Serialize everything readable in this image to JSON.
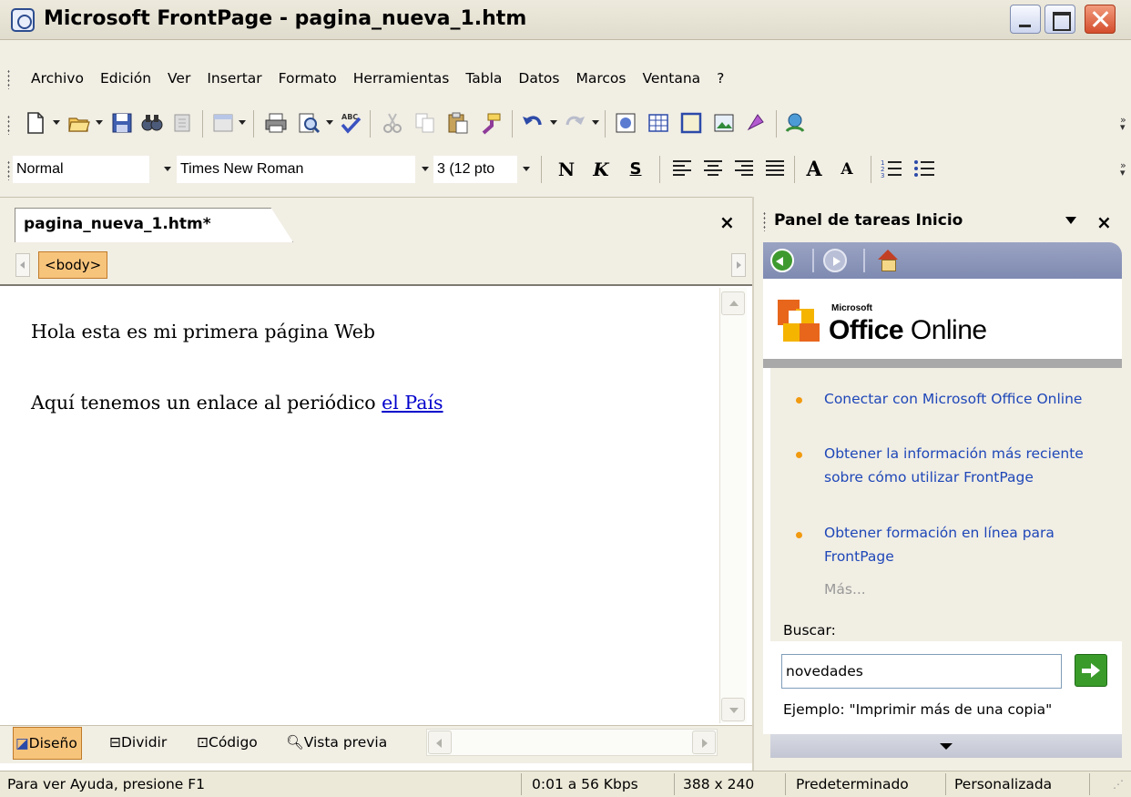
{
  "window": {
    "title": "Microsoft FrontPage - pagina_nueva_1.htm"
  },
  "menu": [
    "Archivo",
    "Edición",
    "Ver",
    "Insertar",
    "Formato",
    "Herramientas",
    "Tabla",
    "Datos",
    "Marcos",
    "Ventana",
    "?"
  ],
  "toolbar1": {
    "icons": [
      "new-page-icon",
      "open-folder-icon",
      "save-icon",
      "search-icon",
      "publish-icon",
      "web-component-icon",
      "print-icon",
      "print-preview-icon",
      "spelling-icon",
      "cut-icon",
      "copy-icon",
      "paste-icon",
      "format-painter-icon",
      "undo-icon",
      "redo-icon",
      "web-component-insert-icon",
      "insert-table-icon",
      "insert-layer-icon",
      "insert-picture-icon",
      "drawing-icon",
      "hyperlink-icon"
    ]
  },
  "toolbar2": {
    "style": "Normal",
    "font": "Times New Roman",
    "size": "3  (12 pto",
    "bold": "N",
    "italic": "K",
    "underline": "S",
    "increase_font": "A",
    "decrease_font": "A"
  },
  "document": {
    "tab": "pagina_nueva_1.htm*",
    "close": "×",
    "tag": "<body>",
    "line1": "Hola esta es mi primera página Web",
    "line2_prefix": "Aquí tenemos un enlace al periódico ",
    "link": "el País"
  },
  "views": {
    "design": "Diseño",
    "split": "Dividir",
    "code": "Código",
    "preview": "Vista previa"
  },
  "taskpane": {
    "title": "Panel de tareas Inicio",
    "close": "×",
    "brand_small": "Microsoft",
    "brand_office": "Office",
    "brand_online": " Online",
    "links": [
      "Conectar con Microsoft Office Online",
      "Obtener la información más reciente sobre cómo utilizar FrontPage",
      "Obtener formación en línea para FrontPage"
    ],
    "more": "Más...",
    "search_label": "Buscar:",
    "search_value": "novedades",
    "example": "Ejemplo:  \"Imprimir más de una copia\""
  },
  "status": {
    "help": "Para ver Ayuda, presione F1",
    "speed": "0:01 a 56 Kbps",
    "size": "388 x 240",
    "mode1": "Predeterminado",
    "mode2": "Personalizada"
  },
  "colors": {
    "accent_orange": "#f7c47c",
    "link_blue": "#1e47b8",
    "go_green": "#3a9b2a"
  }
}
